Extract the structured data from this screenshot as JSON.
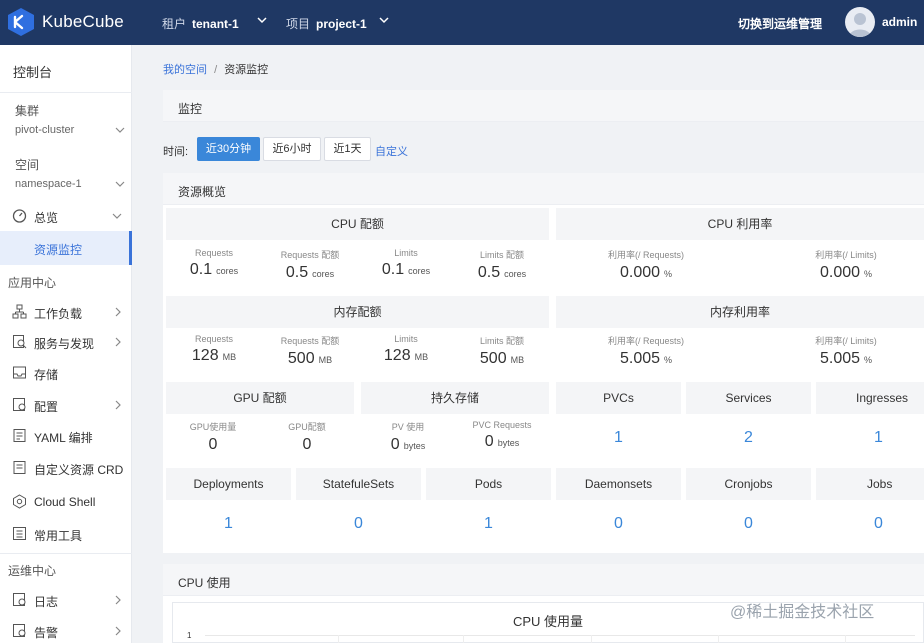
{
  "topbar": {
    "brand": "KubeCube",
    "tenant_label": "租户",
    "tenant_value": "tenant-1",
    "project_label": "项目",
    "project_value": "project-1",
    "ops_link": "切换到运维管理",
    "user": "admin"
  },
  "sidebar": {
    "header": "控制台",
    "cluster_label": "集群",
    "cluster_value": "pivot-cluster",
    "namespace_label": "空间",
    "namespace_value": "namespace-1",
    "overview": "总览",
    "resource_monitor": "资源监控",
    "app_center": "应用中心",
    "items": [
      "工作负载",
      "服务与发现",
      "存储",
      "配置",
      "YAML 编排",
      "自定义资源 CRD",
      "Cloud Shell",
      "常用工具"
    ],
    "ops_center": "运维中心",
    "ops_items": [
      "日志",
      "告警"
    ]
  },
  "breadcrumb": {
    "home": "我的空间",
    "sep": "/",
    "current": "资源监控"
  },
  "monitor": {
    "title": "监控"
  },
  "time": {
    "label": "时间:",
    "options": [
      "近30分钟",
      "近6小时",
      "近1天"
    ],
    "custom": "自定义"
  },
  "overview": {
    "title": "资源概览",
    "cpu_quota": {
      "title": "CPU 配额",
      "stats": [
        {
          "label": "Requests",
          "value": "0.1",
          "unit": "cores"
        },
        {
          "label": "Requests 配额",
          "value": "0.5",
          "unit": "cores"
        },
        {
          "label": "Limits",
          "value": "0.1",
          "unit": "cores"
        },
        {
          "label": "Limits 配额",
          "value": "0.5",
          "unit": "cores"
        }
      ]
    },
    "cpu_usage": {
      "title": "CPU 利用率",
      "stats": [
        {
          "label": "利用率(/ Requests)",
          "value": "0.000",
          "unit": "%"
        },
        {
          "label": "利用率(/ Limits)",
          "value": "0.000",
          "unit": "%"
        }
      ]
    },
    "mem_quota": {
      "title": "内存配额",
      "stats": [
        {
          "label": "Requests",
          "value": "128",
          "unit": "MB"
        },
        {
          "label": "Requests 配额",
          "value": "500",
          "unit": "MB"
        },
        {
          "label": "Limits",
          "value": "128",
          "unit": "MB"
        },
        {
          "label": "Limits 配额",
          "value": "500",
          "unit": "MB"
        }
      ]
    },
    "mem_usage": {
      "title": "内存利用率",
      "stats": [
        {
          "label": "利用率(/ Requests)",
          "value": "5.005",
          "unit": "%"
        },
        {
          "label": "利用率(/ Limits)",
          "value": "5.005",
          "unit": "%"
        }
      ]
    },
    "gpu_quota": {
      "title": "GPU 配额",
      "stats": [
        {
          "label": "GPU使用量",
          "value": "0",
          "unit": ""
        },
        {
          "label": "GPU配额",
          "value": "0",
          "unit": ""
        }
      ]
    },
    "storage": {
      "title": "持久存储",
      "stats": [
        {
          "label": "PV 使用",
          "value": "0",
          "unit": "bytes"
        },
        {
          "label": "PVC Requests",
          "value": "0",
          "unit": "bytes"
        }
      ]
    },
    "counts_row1": [
      {
        "title": "PVCs",
        "value": "1"
      },
      {
        "title": "Services",
        "value": "2"
      },
      {
        "title": "Ingresses",
        "value": "1"
      }
    ],
    "counts_row2": [
      {
        "title": "Deployments",
        "value": "1"
      },
      {
        "title": "StatefuleSets",
        "value": "0"
      },
      {
        "title": "Pods",
        "value": "1"
      },
      {
        "title": "Daemonsets",
        "value": "0"
      },
      {
        "title": "Cronjobs",
        "value": "0"
      },
      {
        "title": "Jobs",
        "value": "0"
      }
    ]
  },
  "cpu_panel": {
    "title": "CPU 使用",
    "chart_title": "CPU 使用量",
    "y_tick": "1"
  },
  "watermark": "@稀土掘金技术社区",
  "colors": {
    "topbar": "#1f3864",
    "accent": "#3a87d9",
    "link": "#3a73d9"
  }
}
